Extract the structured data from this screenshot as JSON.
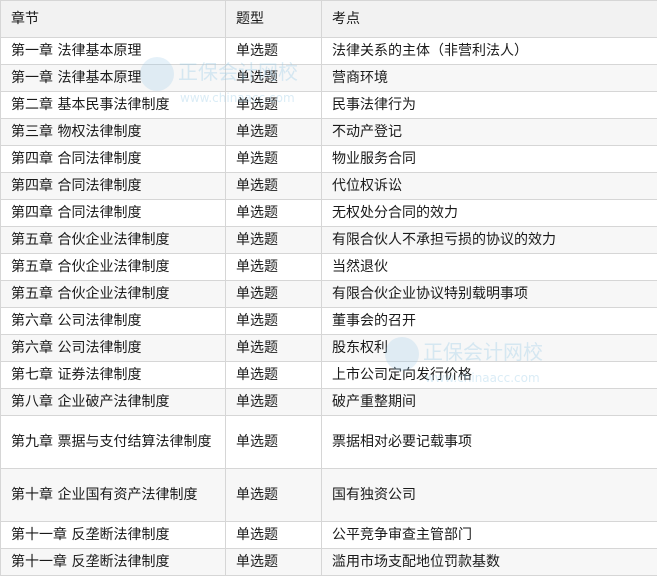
{
  "table": {
    "headers": [
      "章节",
      "题型",
      "考点"
    ],
    "rows": [
      [
        "第一章 法律基本原理",
        "单选题",
        "法律关系的主体（非营利法人）"
      ],
      [
        "第一章 法律基本原理",
        "单选题",
        "营商环境"
      ],
      [
        "第二章 基本民事法律制度",
        "单选题",
        "民事法律行为"
      ],
      [
        "第三章 物权法律制度",
        "单选题",
        "不动产登记"
      ],
      [
        "第四章 合同法律制度",
        "单选题",
        "物业服务合同"
      ],
      [
        "第四章 合同法律制度",
        "单选题",
        "代位权诉讼"
      ],
      [
        "第四章 合同法律制度",
        "单选题",
        "无权处分合同的效力"
      ],
      [
        "第五章 合伙企业法律制度",
        "单选题",
        "有限合伙人不承担亏损的协议的效力"
      ],
      [
        "第五章 合伙企业法律制度",
        "单选题",
        "当然退伙"
      ],
      [
        "第五章 合伙企业法律制度",
        "单选题",
        "有限合伙企业协议特别载明事项"
      ],
      [
        "第六章 公司法律制度",
        "单选题",
        "董事会的召开"
      ],
      [
        "第六章 公司法律制度",
        "单选题",
        "股东权利"
      ],
      [
        "第七章 证券法律制度",
        "单选题",
        "上市公司定向发行价格"
      ],
      [
        "第八章 企业破产法律制度",
        "单选题",
        "破产重整期间"
      ],
      [
        "第九章 票据与支付结算法律制度",
        "单选题",
        "票据相对必要记载事项"
      ],
      [
        "第十章 企业国有资产法律制度",
        "单选题",
        "国有独资公司"
      ],
      [
        "第十一章 反垄断法律制度",
        "单选题",
        "公平竞争审查主管部门"
      ],
      [
        "第十一章 反垄断法律制度",
        "单选题",
        "滥用市场支配地位罚款基数"
      ]
    ],
    "tall_rows": [
      14,
      15
    ]
  },
  "watermarks": [
    {
      "text": "正保会计网校",
      "sub": "www.chinaacc.com"
    },
    {
      "text": "正保会计网校",
      "sub": "www.chinaacc.com"
    }
  ]
}
